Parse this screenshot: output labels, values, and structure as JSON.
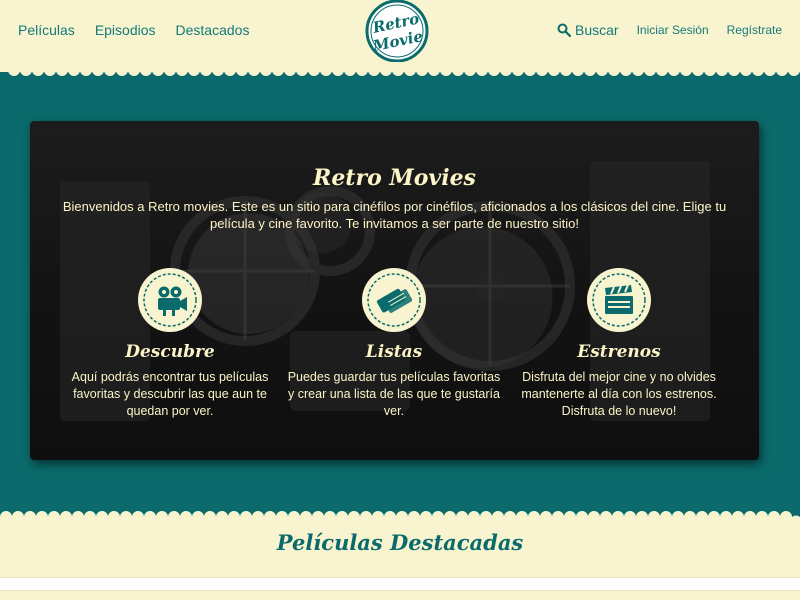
{
  "nav": {
    "left": [
      "Películas",
      "Episodios",
      "Destacados"
    ],
    "search_label": "Buscar",
    "login_label": "Iniciar Sesión",
    "register_label": "Regístrate"
  },
  "logo": {
    "text_top": "Retro",
    "text_bottom": "Movie"
  },
  "hero": {
    "title": "Retro Movies",
    "text": "Bienvenidos a Retro movies. Este es un sitio para cinéfilos por cinéfilos, aficionados a los clásicos del cine. Elige tu película y cine favorito. Te invitamos a ser parte de nuestro sitio!",
    "features": [
      {
        "icon": "movie-camera-icon",
        "title": "Descubre",
        "text": "Aquí podrás encontrar tus películas favoritas y descubrir las que aun te quedan por ver."
      },
      {
        "icon": "tickets-icon",
        "title": "Listas",
        "text": "Puedes guardar tus películas favoritas y crear una lista de las que te gustaría ver."
      },
      {
        "icon": "clapperboard-icon",
        "title": "Estrenos",
        "text": "Disfruta del mejor cine y no olvides mantenerte al día con los estrenos. Disfruta de lo nuevo!"
      }
    ]
  },
  "section": {
    "title": "Películas Destacadas"
  },
  "colors": {
    "cream": "#f8f4cf",
    "teal": "#0b6b6c",
    "hero_text": "#fbf4c6"
  }
}
